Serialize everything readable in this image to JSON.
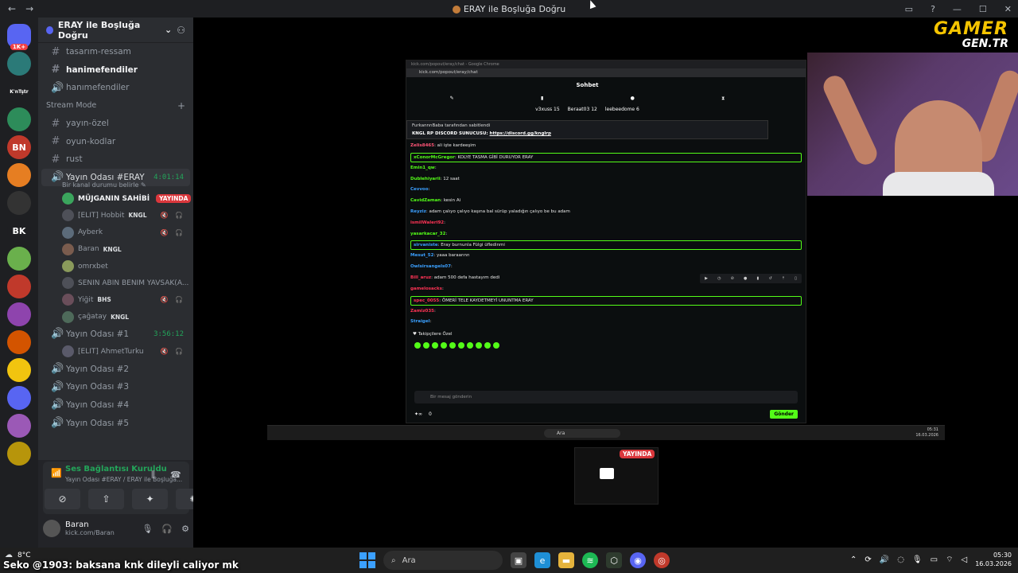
{
  "window": {
    "title": "ERAY ile Boşluğa Doğru",
    "back_icon": "←",
    "forward_icon": "→"
  },
  "server_rail": {
    "items": [
      {
        "label": "1K+",
        "color": "#5865f2"
      },
      {
        "label": "",
        "color": "#2b7a78"
      },
      {
        "label": "K'nTştr",
        "color": "#1e1f22"
      },
      {
        "label": "",
        "color": "#2d8c5a"
      },
      {
        "label": "BN",
        "color": "#c0392b"
      },
      {
        "label": "",
        "color": "#e67e22"
      },
      {
        "label": "",
        "color": "#333"
      },
      {
        "label": "BK",
        "color": "#1e1f22"
      },
      {
        "label": "",
        "color": "#6ab04c"
      },
      {
        "label": "",
        "color": "#c0392b"
      },
      {
        "label": "",
        "color": "#8e44ad"
      },
      {
        "label": "",
        "color": "#d35400"
      },
      {
        "label": "",
        "color": "#f1c40f"
      },
      {
        "label": "",
        "color": "#5865f2"
      },
      {
        "label": "",
        "color": "#9b59b6"
      },
      {
        "label": "",
        "color": "#b7950b"
      }
    ]
  },
  "sidebar": {
    "server_name": "ERAY ile Boşluğa Doğru",
    "channels_top": [
      {
        "name": "tasarım-ressam",
        "type": "#",
        "bright": false
      },
      {
        "name": "hanimefendiler",
        "type": "#",
        "bright": true
      },
      {
        "name": "hanımefendiler",
        "type": "voice",
        "bright": false
      }
    ],
    "category_stream": "Stream Mode",
    "channels_stream": [
      {
        "name": "yayın-özel",
        "type": "#"
      },
      {
        "name": "oyun-kodlar",
        "type": "#"
      },
      {
        "name": "rust",
        "type": "#"
      }
    ],
    "voice_main": {
      "name": "Yayın Odası #ERAY",
      "time": "4:01:14",
      "status": "Bir kanal durumu belirle"
    },
    "voice_main_users": [
      {
        "name": "MÜJGANIN SAHİBİ",
        "live": "YAYINDA",
        "tag": "",
        "icons": "",
        "highlight": true,
        "color": "#3ba55d"
      },
      {
        "name": "[ELIT] Hobbit",
        "live": "",
        "tag": "KNGL",
        "icons": "🔇 🎧",
        "highlight": false,
        "color": "#4e5058"
      },
      {
        "name": "Ayberk",
        "live": "",
        "tag": "",
        "icons": "🔇 🎧",
        "highlight": false,
        "color": "#5c6b7a"
      },
      {
        "name": "Baran",
        "live": "",
        "tag": "KNGL",
        "icons": "",
        "highlight": false,
        "color": "#7a5c4e"
      },
      {
        "name": "omrxbet",
        "live": "",
        "tag": "",
        "icons": "",
        "highlight": false,
        "color": "#8a9a5b"
      },
      {
        "name": "SENIN ABIN BENIM YAVSAK(A...",
        "live": "",
        "tag": "",
        "icons": "",
        "highlight": false,
        "color": "#4e5058"
      },
      {
        "name": "Yiğit",
        "live": "",
        "tag": "BHS",
        "icons": "🔇 🎧",
        "highlight": false,
        "color": "#6a4e5a"
      },
      {
        "name": "çağatay",
        "live": "",
        "tag": "KNGL",
        "icons": "",
        "highlight": false,
        "color": "#4e6a5a"
      }
    ],
    "voice_second": {
      "name": "Yayın Odası #1",
      "time": "3:56:12"
    },
    "voice_second_users": [
      {
        "name": "[ELIT] AhmetTurku",
        "icons": "🔇 🎧",
        "color": "#5a5a6a"
      }
    ],
    "voice_rest": [
      {
        "name": "Yayın Odası #2"
      },
      {
        "name": "Yayın Odası #3"
      },
      {
        "name": "Yayın Odası #4"
      },
      {
        "name": "Yayın Odası #5"
      }
    ]
  },
  "voice_panel": {
    "status": "Ses Bağlantısı Kuruldu",
    "channel": "Yayın Odası #ERAY / ERAY ile Boşluğa...",
    "username": "Baran",
    "user_status": "kick.com/Baran"
  },
  "shared_screen": {
    "chrome_title": "kick.com/popout/eray/chat - Google Chrome",
    "url": "kick.com/popout/eray/chat",
    "header": "Sohbet",
    "top_users": [
      {
        "name": "v3xuss",
        "count": "15"
      },
      {
        "name": "Beraat03",
        "count": "12"
      },
      {
        "name": "leebeedome",
        "count": "6"
      }
    ],
    "pinned_by": "FurkannnBaba tarafından sabitlendi",
    "pinned_text": "KNGL RP DISCORD SUNUCUSU:",
    "pinned_link": "https://discord.gg/knglrp",
    "messages": [
      {
        "user": "Zelis8465",
        "text": ": ali işte kardeeşim",
        "color": "#ff5577",
        "hl": false
      },
      {
        "user": "xConorMcGregor",
        "text": ": KOLYE TASMA GİBİ DURUYOR ERAY",
        "color": "#53fc18",
        "hl": true
      },
      {
        "user": "Emin1_qw",
        "text": ":",
        "color": "#53fc18",
        "hl": false
      },
      {
        "user": "Dublehiyarii",
        "text": ": 12 saat",
        "color": "#53fc18",
        "hl": false
      },
      {
        "user": "Cevvoo",
        "text": ":",
        "color": "#3ba0ff",
        "hl": false
      },
      {
        "user": "CavidZaman",
        "text": ": kesin Ai",
        "color": "#53fc18",
        "hl": false
      },
      {
        "user": "Reyziz",
        "text": ": adam çalıyo çalıyo kaşına bal sürüp yaladığın çalıyo be bu adam",
        "color": "#3ba0ff",
        "hl": false
      },
      {
        "user": "ismilWaleri92",
        "text": ":",
        "color": "#ff3355",
        "hl": false
      },
      {
        "user": "yasarkacar_32",
        "text": ":",
        "color": "#53fc18",
        "hl": false
      },
      {
        "user": "sirvaniste",
        "text": ": Eray burnunla Fülgi üfledinmi",
        "color": "#3ba0ff",
        "hl": true
      },
      {
        "user": "Mesut_52",
        "text": ": yaaa baraannn",
        "color": "#3ba0ff",
        "hl": false
      },
      {
        "user": "Owlsirsangels07",
        "text": ":",
        "color": "#3ba0ff",
        "hl": false
      },
      {
        "user": "Bill_aruz",
        "text": ": adam 500 defa hastayım dedi",
        "color": "#ff3355",
        "hl": false
      },
      {
        "user": "gamelosacks",
        "text": ":",
        "color": "#ff3355",
        "hl": false
      },
      {
        "user": "spec_0055",
        "text": ": ÖMERİ TELE KAYDETMEYİ UNUNTMA ERAY",
        "color": "#ff3355",
        "hl": true
      },
      {
        "user": "Zamiz035",
        "text": ":",
        "color": "#ff3355",
        "hl": false
      },
      {
        "user": "Straigel",
        "text": ":",
        "color": "#3ba0ff",
        "hl": false
      }
    ],
    "followers_only": "Takipçilere Özel",
    "input_placeholder": "Bir mesaj gönderin",
    "points": "0",
    "send_label": "Gönder",
    "inner_search": "Ara",
    "inner_time": "05:31",
    "inner_date": "16.03.2026"
  },
  "logo": {
    "line1": "GAMER",
    "line2": "GEN.TR"
  },
  "mini_preview": {
    "live_label": "YAYINDA"
  },
  "taskbar": {
    "temperature": "8°C",
    "subtitle": "Seko @1903: baksana knk dileyli caliyor mk",
    "search_label": "Ara",
    "time": "05:30",
    "date": "16.03.2026"
  }
}
